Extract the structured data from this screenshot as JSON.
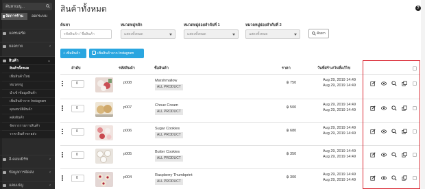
{
  "sidebar": {
    "search_placeholder": "ค้นหาเมนู...",
    "manage_label": "จัดการร้าน",
    "logout_label": "ออกระบบ",
    "items": [
      {
        "label": "แดชบอร์ด",
        "icon": "dashboard-icon"
      },
      {
        "label": "ยอดขาย",
        "icon": "cart-icon"
      },
      {
        "label": "สินค้า",
        "icon": "tag-icon",
        "active": true
      }
    ],
    "submenu": [
      {
        "label": "สินค้าทั้งหมด",
        "active": true
      },
      {
        "label": "เพิ่มสินค้าใหม่"
      },
      {
        "label": "หมวดหมู่"
      },
      {
        "label": "นำเข้าข้อมูลสินค้า"
      },
      {
        "label": "เพิ่มสินค้าจาก Instagram"
      },
      {
        "label": "คุณสมบัติสินค้า"
      },
      {
        "label": "คลังสินค้า"
      },
      {
        "label": "จัดการรายการสินค้า"
      },
      {
        "label": "ราคาสินค้าขายส่ง"
      }
    ],
    "bottom_items": [
      {
        "label": "อี-คอมเมิร์ซ",
        "icon": "store-icon"
      },
      {
        "label": "ข้อมูลการจัดส่ง",
        "icon": "truck-icon"
      },
      {
        "label": "แคมเปญ",
        "icon": "megaphone-icon"
      }
    ]
  },
  "page": {
    "title": "สินค้าทั้งหมด",
    "help": "?"
  },
  "filters": {
    "search_label": "ค้นหา",
    "search_placeholder": "รหัสสินค้า / ชื่อสินค้า",
    "main_cat_label": "หมวดหมู่หลัก",
    "main_cat_value": "แสดงทั้งหมด",
    "sub1_label": "หมวดหมู่ย่อยลำดับที่ 1",
    "sub1_value": "แสดงทั้งหมด",
    "sub2_label": "หมวดหมู่ย่อยลำดับที่ 2",
    "sub2_value": "แสดงทั้งหมด",
    "search_button": "ค้นหา"
  },
  "actions": {
    "add_product": "+ เพิ่มสินค้า",
    "add_instagram": "เพิ่มสินค้าจาก Instagram"
  },
  "table": {
    "headers": {
      "order": "ลำดับ",
      "sku": "รหัสสินค้า",
      "name": "ชื่อสินค้า",
      "price": "ราคา",
      "dates": "วันที่สร้าง/วันที่แก้ไข"
    },
    "rows": [
      {
        "order": "0",
        "sku": "p008",
        "name": "Marshmallow",
        "category": "ALL PRODUCT",
        "price": "฿ 750",
        "created": "Aug 29, 2019 14:49",
        "updated": "Aug 29, 2019 14:49",
        "thumb_color": "#c9a39b"
      },
      {
        "order": "0",
        "sku": "p007",
        "name": "Choux Cream",
        "category": "ALL PRODUCT",
        "price": "฿ 500",
        "created": "Aug 29, 2019 14:49",
        "updated": "Aug 29, 2019 14:49",
        "thumb_color": "#c8a878"
      },
      {
        "order": "0",
        "sku": "p006",
        "name": "Sugar Cookies",
        "category": "ALL PRODUCT",
        "price": "฿ 680",
        "created": "Aug 29, 2019 14:49",
        "updated": "Aug 29, 2019 14:49",
        "thumb_color": "#c98c8c"
      },
      {
        "order": "0",
        "sku": "p005",
        "name": "Butter Cookies",
        "category": "ALL PRODUCT",
        "price": "฿ 350",
        "created": "Aug 29, 2019 14:49",
        "updated": "Aug 29, 2019 14:49",
        "thumb_color": "#d6c9bd"
      },
      {
        "order": "0",
        "sku": "p004",
        "name": "Raspberry Thumbprint",
        "category": "ALL PRODUCT",
        "price": "฿ 300",
        "created": "Aug 29, 2019 14:49",
        "updated": "Aug 29, 2019 14:49",
        "thumb_color": "#c2a7a7"
      }
    ],
    "row_actions": [
      "edit-icon",
      "eye-icon",
      "search-icon",
      "copy-icon"
    ]
  },
  "colors": {
    "sidebar_bg": "#2b2b2b",
    "accent_blue": "#2aa6e0",
    "highlight_red": "#d9232e"
  }
}
